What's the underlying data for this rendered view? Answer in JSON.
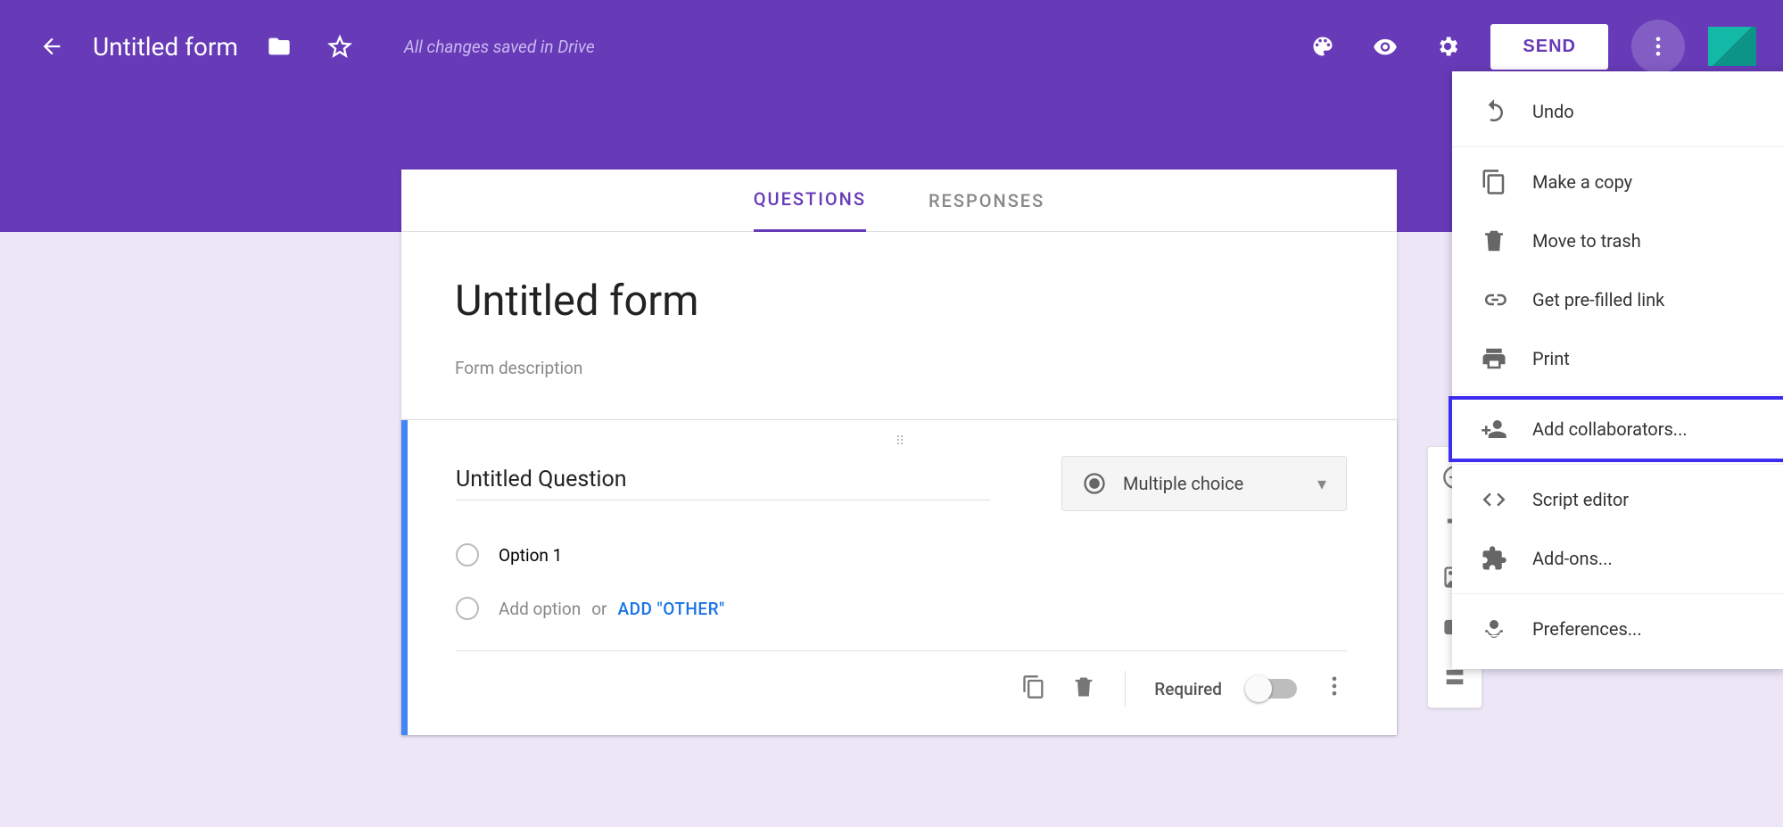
{
  "header": {
    "form_title": "Untitled form",
    "save_status": "All changes saved in Drive",
    "send_label": "SEND"
  },
  "tabs": {
    "questions": "QUESTIONS",
    "responses": "RESPONSES"
  },
  "form": {
    "title": "Untitled form",
    "description_placeholder": "Form description"
  },
  "question": {
    "title": "Untitled Question",
    "type_label": "Multiple choice",
    "option1": "Option 1",
    "add_option": "Add option",
    "or": "or",
    "add_other": "ADD \"OTHER\"",
    "required_label": "Required"
  },
  "menu": {
    "undo": "Undo",
    "make_copy": "Make a copy",
    "move_trash": "Move to trash",
    "prefilled": "Get pre-filled link",
    "print": "Print",
    "add_collab": "Add collaborators...",
    "script_editor": "Script editor",
    "addons": "Add-ons...",
    "preferences": "Preferences..."
  }
}
